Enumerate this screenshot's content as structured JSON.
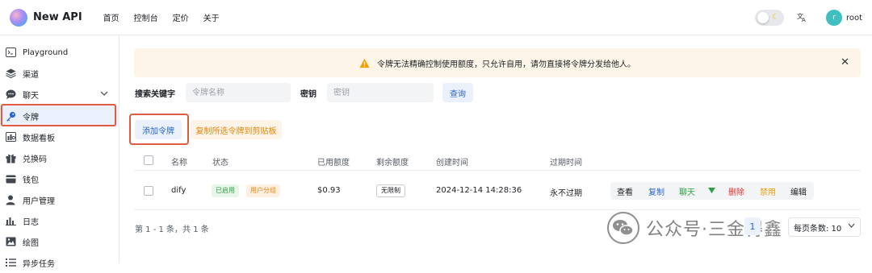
{
  "app": {
    "name": "New API"
  },
  "nav": [
    "首页",
    "控制台",
    "定价",
    "关于"
  ],
  "user": {
    "avatar_letter": "r",
    "name": "root"
  },
  "colors": {
    "accent": "#2a64d6",
    "warning": "#f59f00",
    "danger": "#e03131",
    "success": "#2f9e44",
    "highlight_box": "#e05b3f"
  },
  "sidebar": {
    "items": [
      {
        "label": "Playground",
        "icon": "terminal-icon"
      },
      {
        "label": "渠道",
        "icon": "layers-icon"
      },
      {
        "label": "聊天",
        "icon": "chat-icon",
        "expandable": true
      },
      {
        "label": "令牌",
        "icon": "key-icon",
        "active": true
      },
      {
        "label": "数据看板",
        "icon": "dashboard-icon"
      },
      {
        "label": "兑换码",
        "icon": "gift-icon"
      },
      {
        "label": "钱包",
        "icon": "wallet-icon"
      },
      {
        "label": "用户管理",
        "icon": "user-icon"
      },
      {
        "label": "日志",
        "icon": "histogram-icon"
      },
      {
        "label": "绘图",
        "icon": "image-icon"
      },
      {
        "label": "异步任务",
        "icon": "task-list-icon"
      }
    ]
  },
  "banner": {
    "text": "令牌无法精确控制使用额度，只允许自用，请勿直接将令牌分发给他人。"
  },
  "search": {
    "keyword_label": "搜索关键字",
    "keyword_placeholder": "令牌名称",
    "key_label": "密钥",
    "key_placeholder": "密钥",
    "query_button": "查询"
  },
  "toolbar": {
    "add_token": "添加令牌",
    "copy_selected": "复制所选令牌到剪贴板"
  },
  "table": {
    "columns": [
      "名称",
      "状态",
      "已用额度",
      "剩余额度",
      "创建时间",
      "过期时间"
    ],
    "rows": [
      {
        "name": "dify",
        "status": "已启用",
        "group": "用户分组",
        "used": "$0.93",
        "remaining": "无限制",
        "created": "2024-12-14 14:28:36",
        "expires": "永不过期",
        "actions": [
          "查看",
          "复制",
          "聊天",
          "删除",
          "禁用",
          "编辑"
        ]
      }
    ]
  },
  "footer": {
    "summary": "第 1 - 1 条，共 1 条",
    "page": "1",
    "page_size": "每页条数: 10"
  },
  "watermark": {
    "text": "公众号·三金得鑫"
  }
}
